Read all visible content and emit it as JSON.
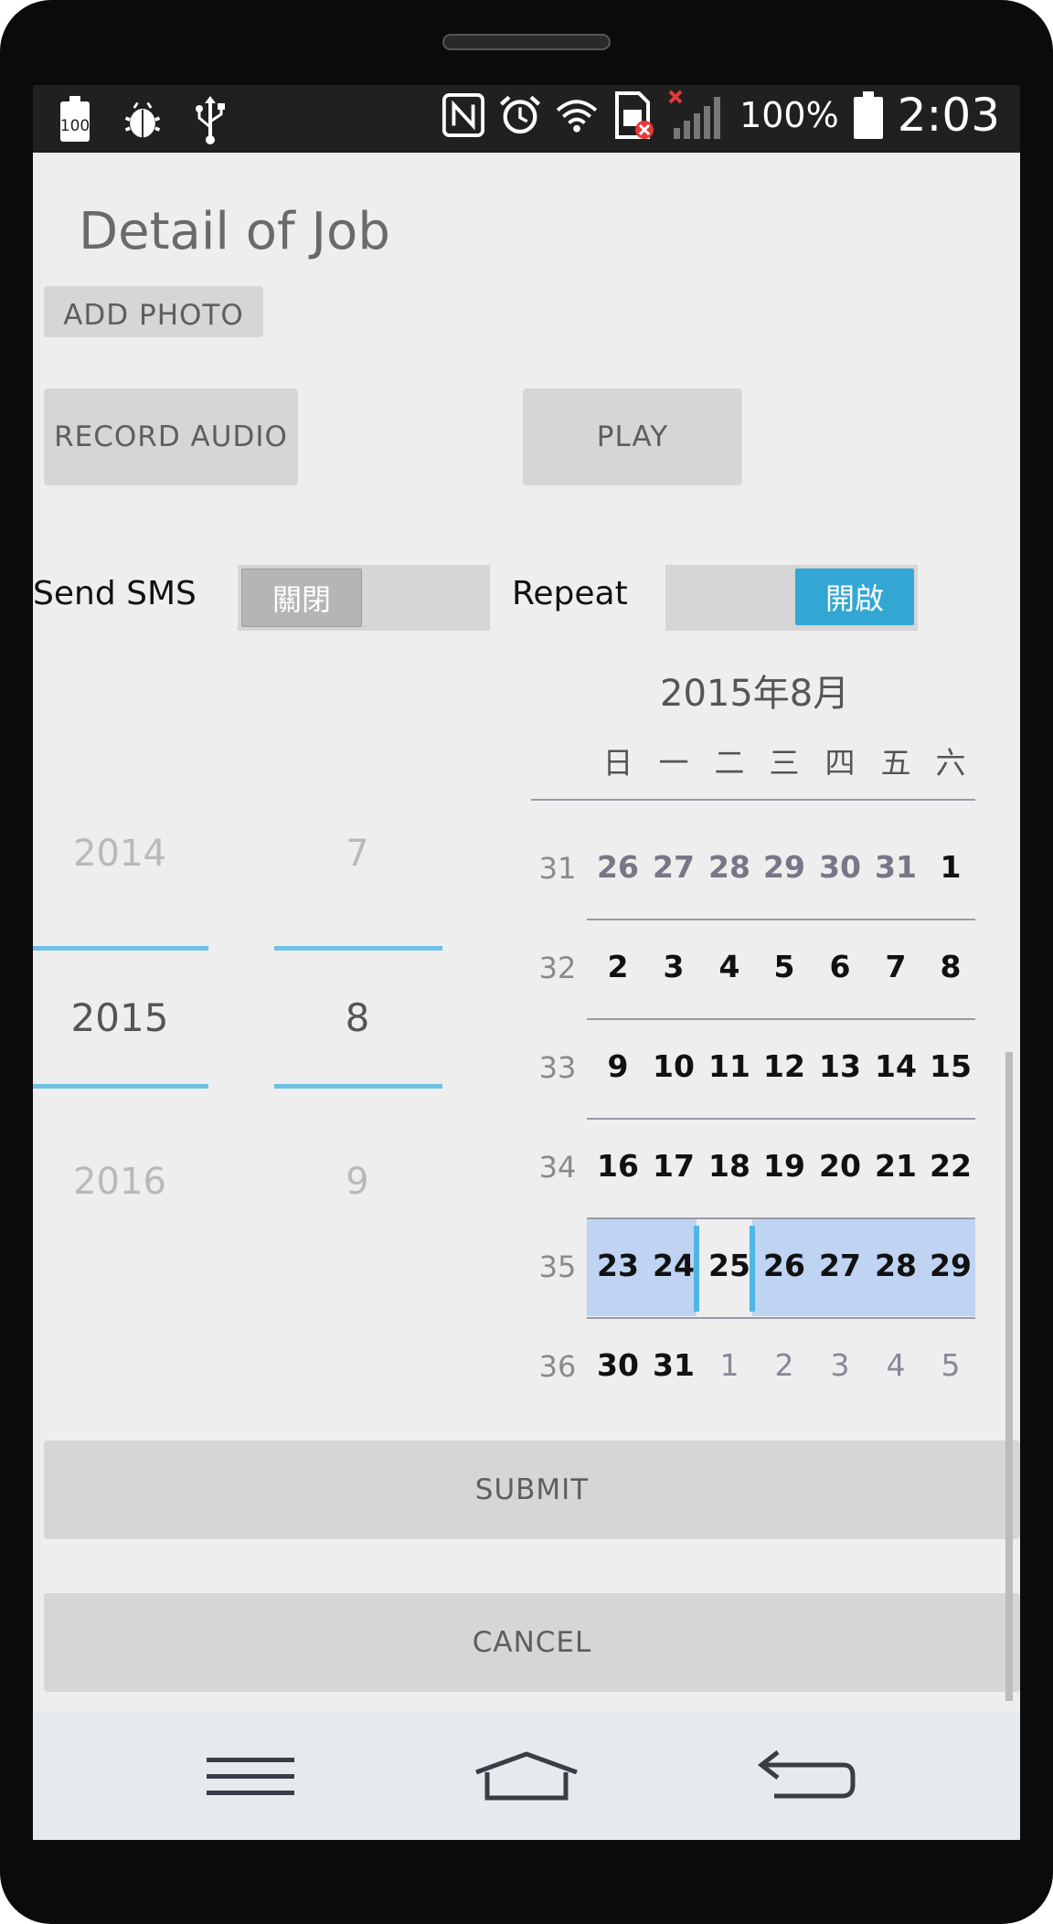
{
  "status_bar": {
    "battery_badge": "100",
    "battery_percent": "100%",
    "time": "2:03",
    "icons": [
      "battery-100-icon",
      "debug-bug-icon",
      "usb-icon",
      "nfc-icon",
      "alarm-icon",
      "wifi-icon",
      "sim-error-icon",
      "no-signal-icon",
      "battery-icon"
    ]
  },
  "header": {
    "title": "Detail of Job"
  },
  "buttons": {
    "add_photo": "ADD PHOTO",
    "record_audio": "RECORD AUDIO",
    "play": "PLAY",
    "submit": "SUBMIT",
    "cancel": "CANCEL"
  },
  "toggles": {
    "send_sms": {
      "label": "Send SMS",
      "state_text": "關閉",
      "on": false
    },
    "repeat": {
      "label": "Repeat",
      "state_text": "開啟",
      "on": true
    }
  },
  "date_picker": {
    "year": {
      "prev": "2014",
      "selected": "2015",
      "next": "2016"
    },
    "month": {
      "prev": "7",
      "selected": "8",
      "next": "9"
    }
  },
  "calendar": {
    "month_title": "2015年8月",
    "weekdays": [
      "日",
      "一",
      "二",
      "三",
      "四",
      "五",
      "六"
    ],
    "weeks": [
      {
        "week": "31",
        "days": [
          "26",
          "27",
          "28",
          "29",
          "30",
          "31",
          "1"
        ]
      },
      {
        "week": "32",
        "days": [
          "2",
          "3",
          "4",
          "5",
          "6",
          "7",
          "8"
        ]
      },
      {
        "week": "33",
        "days": [
          "9",
          "10",
          "11",
          "12",
          "13",
          "14",
          "15"
        ]
      },
      {
        "week": "34",
        "days": [
          "16",
          "17",
          "18",
          "19",
          "20",
          "21",
          "22"
        ]
      },
      {
        "week": "35",
        "days": [
          "23",
          "24",
          "25",
          "26",
          "27",
          "28",
          "29"
        ]
      },
      {
        "week": "36",
        "days": [
          "30",
          "31",
          "1",
          "2",
          "3",
          "4",
          "5"
        ]
      }
    ],
    "selected_day": "25"
  },
  "colors": {
    "accent": "#33a7d4",
    "selection_line": "#6ec0e6",
    "week_highlight": "#bfd3f2",
    "screen_bg": "#eeeeee",
    "button_bg": "#d6d6d6"
  }
}
